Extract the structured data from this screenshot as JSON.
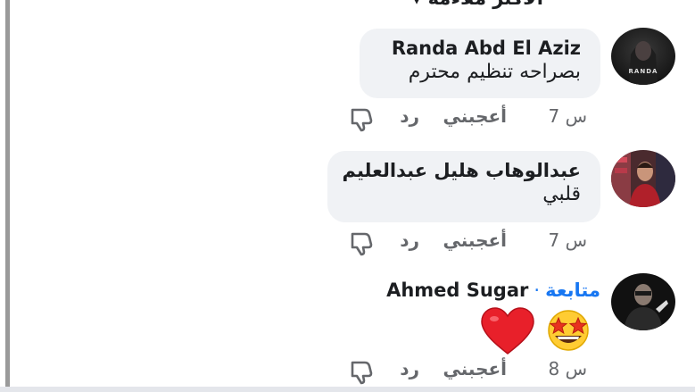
{
  "header": {
    "partial_title": "الأكثر ملاءمة ▾"
  },
  "comments": [
    {
      "author": "Randa Abd El Aziz",
      "text": "بصراحه تنظيم محترم",
      "avatar_caption": "RANDA",
      "time": "7 س",
      "like_label": "أعجبني",
      "reply_label": "رد"
    },
    {
      "author": "عبدالوهاب هليل عبدالعليم",
      "text": "قلبي",
      "time": "7 س",
      "like_label": "أعجبني",
      "reply_label": "رد"
    },
    {
      "author": "Ahmed Sugar",
      "follow_label": "متابعة",
      "separator": "·",
      "emojis": [
        "star-struck-emoji",
        "red-heart-emoji"
      ],
      "time": "8 س",
      "like_label": "أعجبني",
      "reply_label": "رد"
    }
  ],
  "colors": {
    "bubble": "#f0f2f5",
    "meta": "#65676b",
    "link": "#1877f2"
  }
}
